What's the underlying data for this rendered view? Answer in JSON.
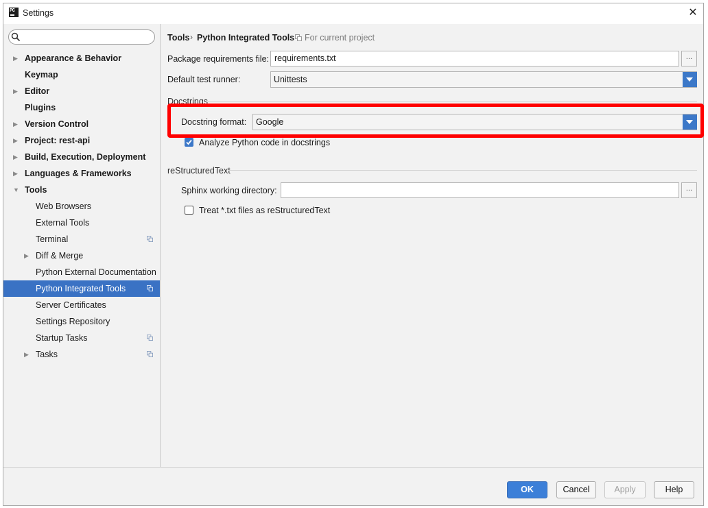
{
  "window": {
    "title": "Settings",
    "app_icon_text": "PC",
    "close_glyph": "✕"
  },
  "sidebar": {
    "search_placeholder": "",
    "items": [
      {
        "label": "Appearance & Behavior",
        "expandable": true,
        "expanded": false,
        "level": 0
      },
      {
        "label": "Keymap",
        "expandable": false,
        "level": 0
      },
      {
        "label": "Editor",
        "expandable": true,
        "expanded": false,
        "level": 0
      },
      {
        "label": "Plugins",
        "expandable": false,
        "level": 0
      },
      {
        "label": "Version Control",
        "expandable": true,
        "expanded": false,
        "level": 0
      },
      {
        "label": "Project: rest-api",
        "expandable": true,
        "expanded": false,
        "level": 0
      },
      {
        "label": "Build, Execution, Deployment",
        "expandable": true,
        "expanded": false,
        "level": 0
      },
      {
        "label": "Languages & Frameworks",
        "expandable": true,
        "expanded": false,
        "level": 0
      },
      {
        "label": "Tools",
        "expandable": true,
        "expanded": true,
        "level": 0
      },
      {
        "label": "Web Browsers",
        "level": 1
      },
      {
        "label": "External Tools",
        "level": 1
      },
      {
        "label": "Terminal",
        "level": 1,
        "project_icon": "copy-icon"
      },
      {
        "label": "Diff & Merge",
        "level": 1,
        "expandable": true,
        "expanded": false
      },
      {
        "label": "Python External Documentation",
        "level": 1
      },
      {
        "label": "Python Integrated Tools",
        "level": 1,
        "selected": true,
        "project_icon": "copy-icon"
      },
      {
        "label": "Server Certificates",
        "level": 1
      },
      {
        "label": "Settings Repository",
        "level": 1
      },
      {
        "label": "Startup Tasks",
        "level": 1,
        "project_icon": "copy-icon"
      },
      {
        "label": "Tasks",
        "level": 1,
        "expandable": true,
        "expanded": false,
        "project_icon": "copy-icon"
      }
    ]
  },
  "breadcrumb": {
    "root": "Tools",
    "separator": "›",
    "page": "Python Integrated Tools",
    "scope": "For current project"
  },
  "form": {
    "package_req_label": "Package requirements file:",
    "package_req_value": "requirements.txt",
    "browse_glyph": "...",
    "test_runner_label": "Default test runner:",
    "test_runner_value": "Unittests",
    "docstrings_section": "Docstrings",
    "docstring_format_label": "Docstring format:",
    "docstring_format_value": "Google",
    "analyze_label": "Analyze Python code in docstrings",
    "analyze_checked": true,
    "rst_section": "reStructuredText",
    "sphinx_label": "Sphinx working directory:",
    "sphinx_value": "",
    "treat_txt_label": "Treat *.txt files as reStructuredText",
    "treat_txt_checked": false
  },
  "buttons": {
    "ok": "OK",
    "cancel": "Cancel",
    "apply": "Apply",
    "help": "Help"
  },
  "colors": {
    "accent": "#3c78c8",
    "selection": "#3a72c4",
    "highlight": "#ff0000",
    "ok_button": "#3c7fd8"
  }
}
